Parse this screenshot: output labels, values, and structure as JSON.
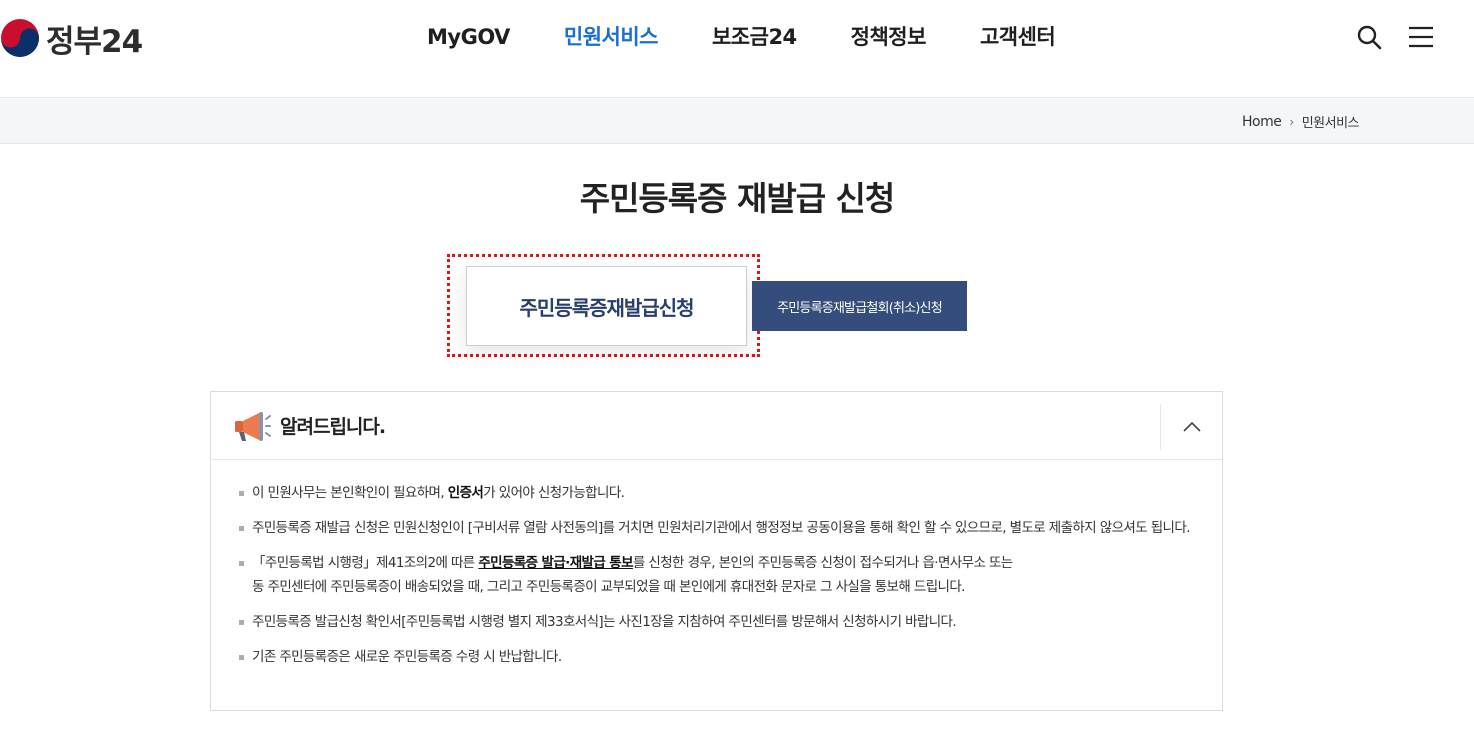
{
  "header": {
    "logo_text": "정부24",
    "nav": [
      "MyGOV",
      "민원서비스",
      "보조금24",
      "정책정보",
      "고객센터"
    ],
    "active_nav": 1,
    "icons": [
      "search-icon",
      "menu-icon"
    ]
  },
  "breadcrumb": {
    "home": "Home",
    "current": "민원서비스"
  },
  "page": {
    "title": "주민등록증 재발급 신청"
  },
  "buttons": {
    "main": "주민등록증재발급신청",
    "sub": "주민등록증재발급철회(취소)신청"
  },
  "notice": {
    "title": "알려드립니다.",
    "items": {
      "i1_a": "이 민원사무는 본인확인이 필요하며, ",
      "i1_b": "인증서",
      "i1_c": "가 있어야 신청가능합니다.",
      "i2": "주민등록증 재발급 신청은 민원신청인이 [구비서류 열람 사전동의]를 거치면 민원처리기관에서 행정정보 공동이용을 통해 확인 할 수 있으므로, 별도로 제출하지 않으셔도 됩니다.",
      "i3_a": "「주민등록법 시행령」제41조의2에 따른 ",
      "i3_b": "주민등록증 발급·재발급 통보",
      "i3_c": "를 신청한 경우, 본인의 주민등록증 신청이 접수되거나 읍·면사무소 또는",
      "i3_d": "동 주민센터에 주민등록증이 배송되었을 때, 그리고 주민등록증이 교부되었을 때 본인에게 휴대전화 문자로 그 사실을 통보해 드립니다.",
      "i4": "주민등록증 발급신청 확인서[주민등록법 시행령 별지 제33호서식]는 사진1장을 지참하여 주민센터를 방문해서 신청하시기 바랍니다.",
      "i5": "기존 주민등록증은 새로운 주민등록증 수령 시 반납합니다."
    }
  },
  "colors": {
    "accent": "#1a6fd1",
    "button_navy": "#344d7c",
    "highlight": "#e01515"
  }
}
